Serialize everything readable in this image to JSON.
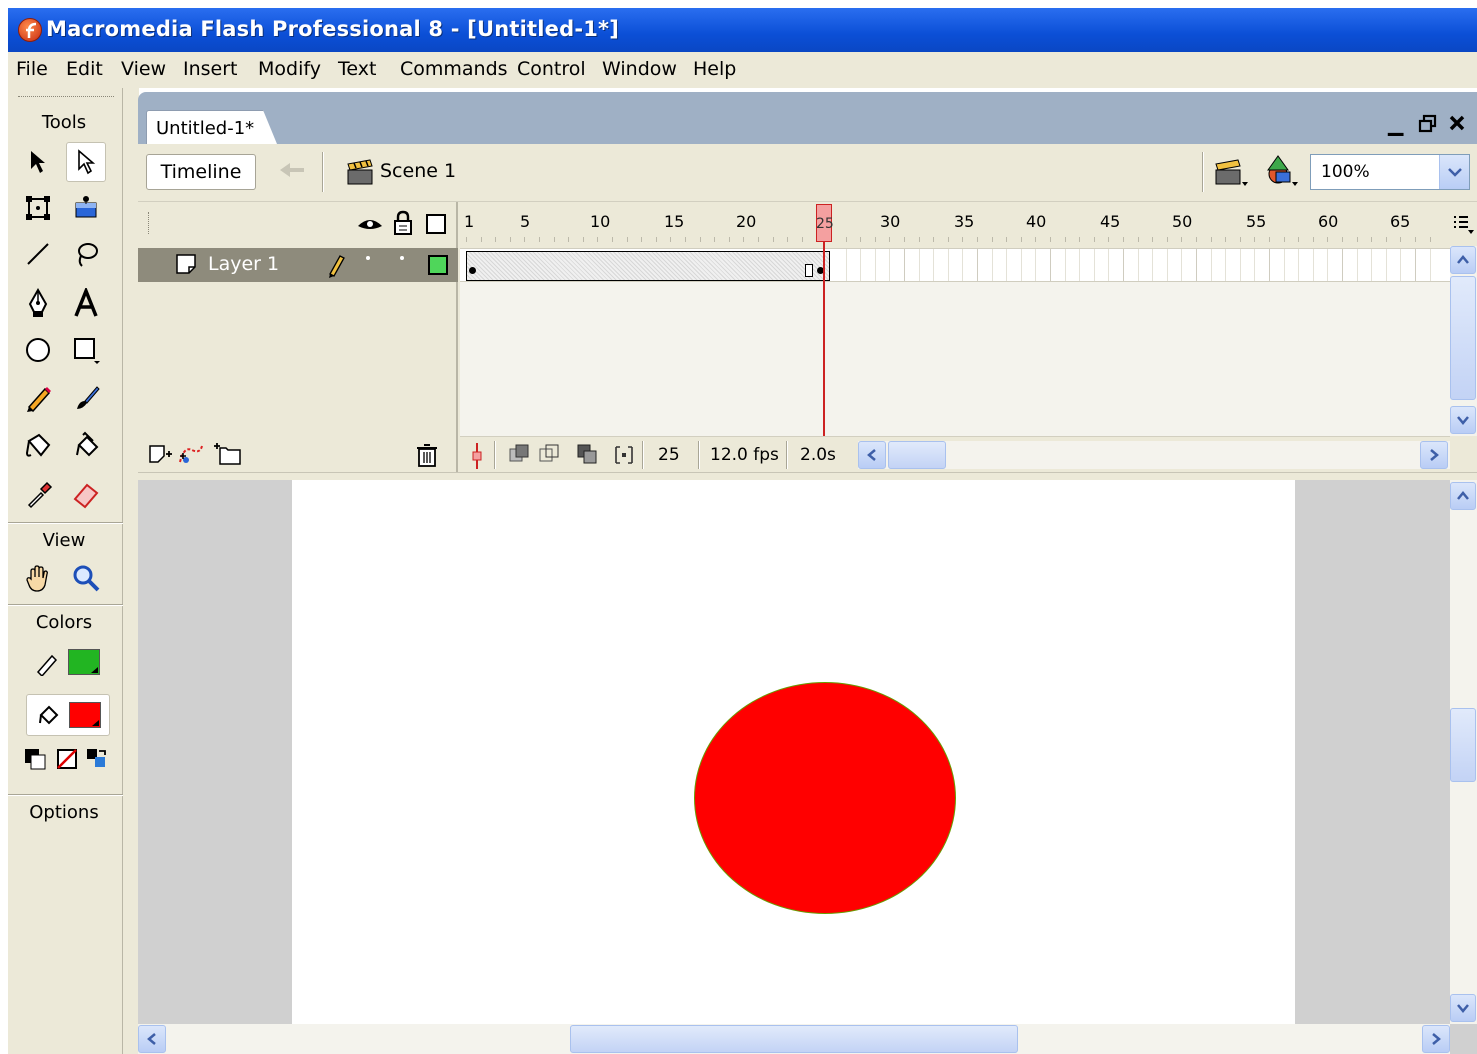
{
  "window": {
    "title": "Macromedia Flash Professional 8 - [Untitled-1*]"
  },
  "menubar": {
    "items": [
      "File",
      "Edit",
      "View",
      "Insert",
      "Modify",
      "Text",
      "Commands",
      "Control",
      "Window",
      "Help"
    ]
  },
  "tools_panel": {
    "heading_tools": "Tools",
    "heading_view": "View",
    "heading_colors": "Colors",
    "heading_options": "Options",
    "stroke_color": "#22b522",
    "fill_color": "#ff0000"
  },
  "document": {
    "tab_label": "Untitled-1*",
    "timeline_button": "Timeline",
    "scene_label": "Scene 1",
    "zoom": "100%"
  },
  "timeline": {
    "layer_name": "Layer 1",
    "frame_numbers": [
      "1",
      "5",
      "10",
      "15",
      "20",
      "25",
      "30",
      "35",
      "40",
      "45",
      "50",
      "55",
      "60",
      "65"
    ],
    "current_frame": "25",
    "frame_rate": "12.0 fps",
    "elapsed_time": "2.0s"
  },
  "stage": {
    "shape": "ellipse",
    "fill": "#ff0000",
    "stroke": "#6a9a00"
  }
}
